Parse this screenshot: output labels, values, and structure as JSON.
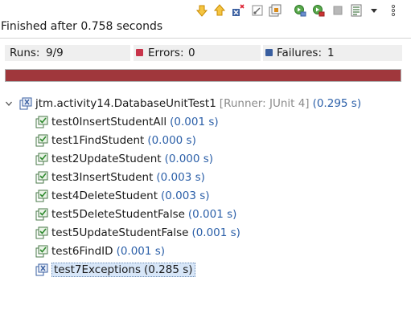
{
  "toolbar": {
    "icons": [
      "next-failure-icon",
      "previous-failure-icon",
      "show-failures-only-icon",
      "scroll-lock-icon",
      "show-skipped-icon",
      "rerun-test-icon",
      "rerun-failed-first-icon",
      "stop-icon",
      "test-run-history-icon",
      "view-menu-icon",
      "more-options-icon"
    ]
  },
  "status": "Finished after 0.758 seconds",
  "counters": {
    "runs_label": "Runs:",
    "runs_value": "9/9",
    "errors_label": "Errors:",
    "errors_value": "0",
    "failures_label": "Failures:",
    "failures_value": "1"
  },
  "progress": {
    "fraction": 1.0,
    "color": "#a0373c"
  },
  "tree": {
    "suite": {
      "name": "jtm.activity14.DatabaseUnitTest1",
      "runner": "[Runner: JUnit 4]",
      "time": "(0.295 s)"
    },
    "tests": [
      {
        "name": "test0InsertStudentAll",
        "time": "(0.001 s)",
        "status": "pass"
      },
      {
        "name": "test1FindStudent",
        "time": "(0.000 s)",
        "status": "pass"
      },
      {
        "name": "test2UpdateStudent",
        "time": "(0.000 s)",
        "status": "pass"
      },
      {
        "name": "test3InsertStudent",
        "time": "(0.003 s)",
        "status": "pass"
      },
      {
        "name": "test4DeleteStudent",
        "time": "(0.003 s)",
        "status": "pass"
      },
      {
        "name": "test5DeleteStudentFalse",
        "time": "(0.001 s)",
        "status": "pass"
      },
      {
        "name": "test5UpdateStudentFalse",
        "time": "(0.001 s)",
        "status": "pass"
      },
      {
        "name": "test6FindID",
        "time": "(0.001 s)",
        "status": "pass"
      },
      {
        "name": "test7Exceptions",
        "time": "(0.285 s)",
        "status": "fail",
        "selected": true
      }
    ]
  }
}
